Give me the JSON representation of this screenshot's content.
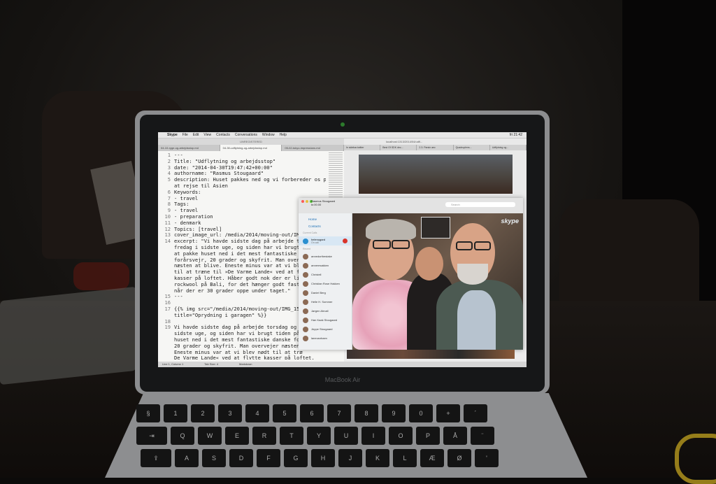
{
  "screen": {
    "menubar": {
      "apple": "",
      "app": "Skype",
      "items": [
        "File",
        "Edit",
        "View",
        "Contacts",
        "Conversations",
        "Window",
        "Help"
      ],
      "clock": "fri 21:42"
    },
    "editor": {
      "title": "UNREGISTERED",
      "tabs": [
        "04-10-ryge-og-arbejdsstop.md",
        "04-30-udflytning-og-arbejdsstop.md",
        "05-02-tokyo-impressions.md"
      ],
      "lines": [
        {
          "n": "1",
          "t": "---"
        },
        {
          "n": "2",
          "t": "Title: \"Udflytning og arbejdsstop\""
        },
        {
          "n": "3",
          "t": "date: \"2014-04-30T19:47:42+00:00\""
        },
        {
          "n": "4",
          "t": "authorname: \"Rasmus Stougaard\""
        },
        {
          "n": "5",
          "t": "description: Huset pakkes ned og vi forbereder os på"
        },
        {
          "n": "",
          "t": "at rejse til Asien"
        },
        {
          "n": "6",
          "t": "Keywords:"
        },
        {
          "n": "7",
          "t": "- travel"
        },
        {
          "n": "8",
          "t": "Tags:"
        },
        {
          "n": "9",
          "t": "- travel"
        },
        {
          "n": "10",
          "t": "- preparation"
        },
        {
          "n": "11",
          "t": "- denmark"
        },
        {
          "n": "12",
          "t": "Topics: [travel]"
        },
        {
          "n": "13",
          "t": "cover_image_url: /media/2014/moving-out/IMG"
        },
        {
          "n": "14",
          "t": "excerpt: \"Vi havde sidste dag på arbejde to"
        },
        {
          "n": "",
          "t": "fredag i sidste uge, og siden har vi brugt"
        },
        {
          "n": "",
          "t": "at pakke huset ned i det mest fantastiske d"
        },
        {
          "n": "",
          "t": "forårsvejr, 20 grader og skyfrit. Man overv"
        },
        {
          "n": "",
          "t": "næsten at blive. Eneste minus var at vi ble"
        },
        {
          "n": "",
          "t": "til at træne til »De Varme Lande« ved at f"
        },
        {
          "n": "",
          "t": "kasser på loftet. Håber godt nok der er lid"
        },
        {
          "n": "",
          "t": "rockwool på Bali, for det hænger godt fast"
        },
        {
          "n": "",
          "t": "når der er 30 grader oppe under taget.\""
        },
        {
          "n": "15",
          "t": "---"
        },
        {
          "n": "16",
          "t": ""
        },
        {
          "n": "17",
          "t": "{{% img src=\"/media/2014/moving-out/IMG_153"
        },
        {
          "n": "",
          "t": "title=\"Oprydning i garagen\" %}}"
        },
        {
          "n": "18",
          "t": ""
        },
        {
          "n": "19",
          "t": "Vi havde sidste dag på arbejde torsdag og f"
        },
        {
          "n": "",
          "t": "sidste uge, og siden har vi brugt tiden på"
        },
        {
          "n": "",
          "t": "huset ned i det mest fantastiske danske for"
        },
        {
          "n": "",
          "t": "20 grader og skyfrit. Man overvejer næsten"
        },
        {
          "n": "",
          "t": "Eneste minus var at vi blev nødt til at træ"
        },
        {
          "n": "",
          "t": "De Varme Lande« ved at flytte kasser på loftet."
        }
      ],
      "status": [
        "Line 1, Column 1",
        "Tab Size: 4",
        "Markdown"
      ]
    },
    "browser": {
      "url": "localhost:1313/2014/04/udfl...",
      "tabs": [
        "In sidebar.twitter",
        "Best Of SDK dec...",
        "2.3. Parsin aec",
        "Quadruplens...",
        "Udflytning og..."
      ],
      "window_label": "Skype"
    },
    "skype": {
      "user_name": "Rasmus Stougaard",
      "user_status": "kr.00.00",
      "search_placeholder": "Search",
      "nav": [
        "Home",
        "Contacts"
      ],
      "current_call_group": "Current Calls",
      "active_call": "helenugard",
      "active_call_sub": "On call",
      "recent_group": "Recent",
      "contacts": [
        "annedorthestake",
        "anneresakken",
        "Christell",
        "Christian Rose Hakken",
        "Daniel Berg",
        "Helle H. Sommer",
        "Jørgen Ahnall",
        "Han Kaak Stougaard",
        "Jeppe Stougaard",
        "laneusnhaen"
      ],
      "brand": "skype"
    },
    "laptop_brand": "MacBook Air"
  },
  "keyboard": {
    "rows": [
      [
        "§",
        "1",
        "2",
        "3",
        "4",
        "5",
        "6",
        "7",
        "8",
        "9",
        "0",
        "+",
        "´"
      ],
      [
        "⇥",
        "Q",
        "W",
        "E",
        "R",
        "T",
        "Y",
        "U",
        "I",
        "O",
        "P",
        "Å",
        "¨"
      ],
      [
        "⇪",
        "A",
        "S",
        "D",
        "F",
        "G",
        "H",
        "J",
        "K",
        "L",
        "Æ",
        "Ø",
        "'"
      ]
    ]
  }
}
